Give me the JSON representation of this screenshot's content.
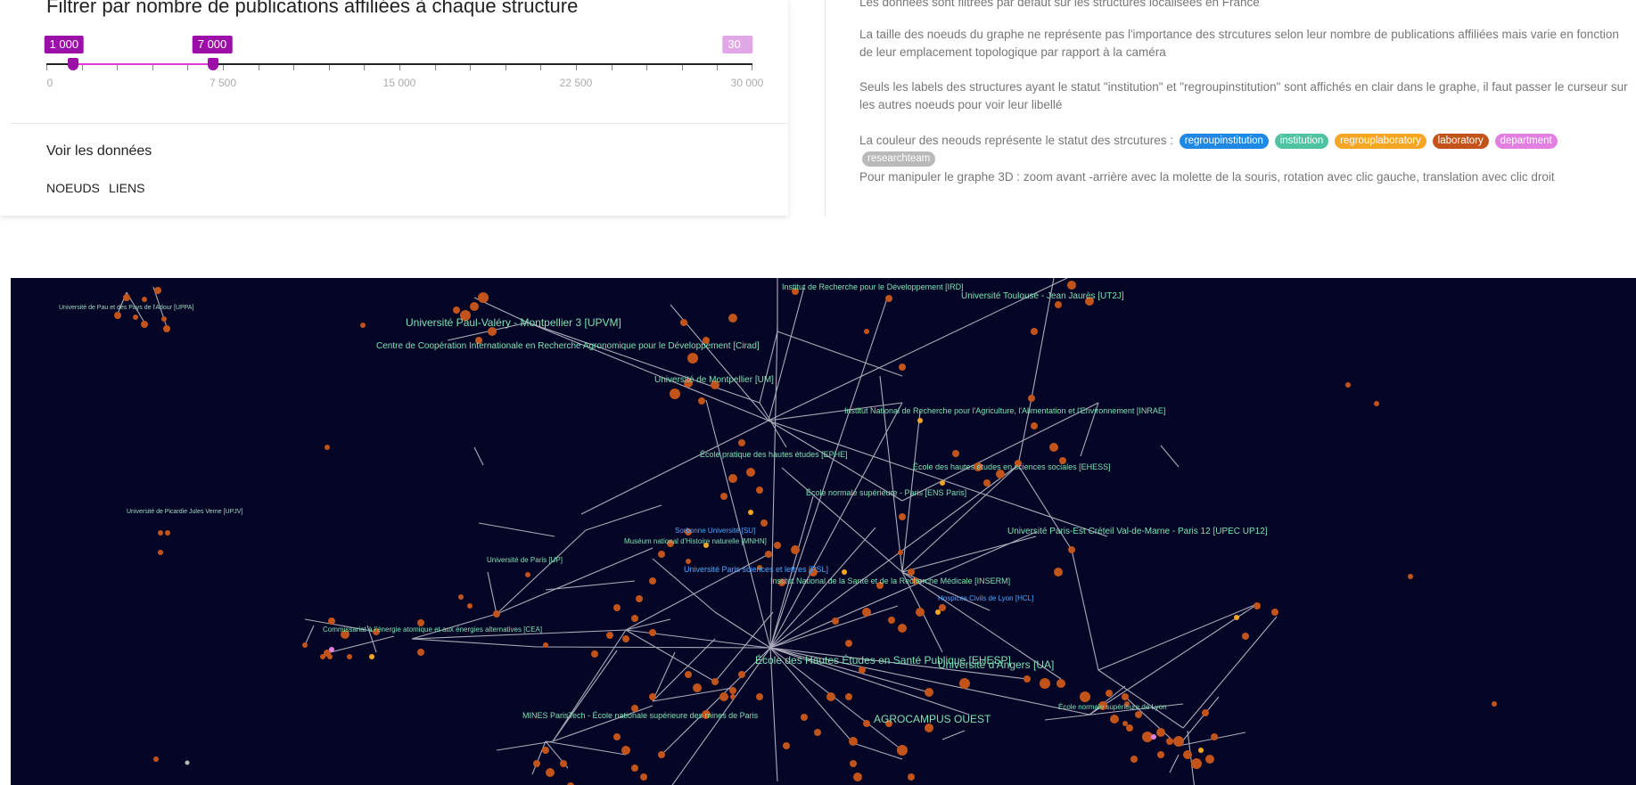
{
  "filter": {
    "title": "Filtrer par nombre de publications affiliées à chaque structure",
    "min_badge": "1 000",
    "value_badge": "7 000",
    "max_badge": "30 000",
    "range_min": 0,
    "range_max": 30000,
    "selected_low": 1000,
    "selected_high": 7000,
    "ticks": [
      "0",
      "7 500",
      "15 000",
      "22 500",
      "30 000"
    ]
  },
  "data_section": {
    "title": "Voir les données",
    "tabs": [
      "NOEUDS",
      "LIENS"
    ]
  },
  "info": {
    "line1": "Les données sont filtrées par défaut sur les structures localisées en France",
    "line2": "La taille des noeuds du graphe ne représente pas l'importance des strcutures selon leur nombre de publications affiliées mais varie en fonction de leur emplacement topologique par rapport à la caméra",
    "line3": "Seuls les labels des structures ayant le statut \"institution\" et \"regroupinstitution\" sont affichés en clair dans le graphe, il faut passer le curseur sur les autres noeuds pour voir leur libellé",
    "line4": "La couleur des neouds représente le statut des strcutures :",
    "line5": "Pour manipuler le graphe 3D : zoom avant -arrière avec la molette de la souris, rotation avec clic gauche, translation avec clic droit",
    "legend": [
      {
        "label": "regroupinstitution",
        "color": "#1e88e5"
      },
      {
        "label": "institution",
        "color": "#4fc3a1"
      },
      {
        "label": "regrouplaboratory",
        "color": "#f5a623"
      },
      {
        "label": "laboratory",
        "color": "#c2541b"
      },
      {
        "label": "department",
        "color": "#e27fe0"
      },
      {
        "label": "researchteam",
        "color": "#b9b9b9"
      }
    ]
  },
  "graph": {
    "labels": [
      {
        "text": "Université Paul-Valéry - Montpellier 3 [UPVM]",
        "size": "big",
        "color": "green"
      },
      {
        "text": "Centre de Coopération Internationale en Recherche Agronomique pour le Développement [Cirad]",
        "size": "med",
        "color": "green"
      },
      {
        "text": "Université de Montpellier [UM]",
        "size": "med",
        "color": "green"
      },
      {
        "text": "Institut de Recherche pour le Développement [IRD]",
        "size": "med",
        "color": "green"
      },
      {
        "text": "Université Toulouse - Jean Jaurès [UT2J]",
        "size": "med",
        "color": "green"
      },
      {
        "text": "Institut National de Recherche pour l'Agriculture, l'Alimentation et l'Environnement [INRAE]",
        "size": "med",
        "color": "green"
      },
      {
        "text": "École pratique des hautes études [EPHE]",
        "size": "med",
        "color": "green"
      },
      {
        "text": "École des hautes études en sciences sociales [EHESS]",
        "size": "med",
        "color": "green"
      },
      {
        "text": "École normale supérieure - Paris [ENS Paris]",
        "size": "med",
        "color": "green"
      },
      {
        "text": "Université Paris-Est Créteil Val-de-Marne - Paris 12 [UPEC UP12]",
        "size": "med",
        "color": "green"
      },
      {
        "text": "Université Paris sciences et lettres [PSL]",
        "size": "med",
        "color": "blue"
      },
      {
        "text": "Institut National de la Santé et de la Recherche Médicale [INSERM]",
        "size": "med",
        "color": "green"
      },
      {
        "text": "Université de Paris [UP]",
        "size": "med",
        "color": "green"
      },
      {
        "text": "Commissariat à l'énergie atomique et aux énergies alternatives [CEA]",
        "size": "med",
        "color": "green"
      },
      {
        "text": "École des Hautes Études en Santé Publique [EHESP]",
        "size": "big",
        "color": "green"
      },
      {
        "text": "Université d'Angers [UA]",
        "size": "big",
        "color": "green"
      },
      {
        "text": "MINES ParisTech - École nationale supérieure des mines de Paris",
        "size": "med",
        "color": "green"
      },
      {
        "text": "AGROCAMPUS OUEST",
        "size": "big",
        "color": "green"
      },
      {
        "text": "Université de Pau et des Pays de l'Adour [UPPA]",
        "size": "sm",
        "color": "green"
      },
      {
        "text": "Université de Picardie Jules Verne [UPJV]",
        "size": "sm",
        "color": "green"
      },
      {
        "text": "Hospices Civils de Lyon [HCL]",
        "size": "med",
        "color": "blue"
      },
      {
        "text": "École normale supérieure de Lyon",
        "size": "med",
        "color": "green"
      },
      {
        "text": "Sorbonne Université [SU]",
        "size": "med",
        "color": "blue"
      },
      {
        "text": "Muséum national d'Histoire naturelle [MNHN]",
        "size": "med",
        "color": "green"
      }
    ]
  }
}
